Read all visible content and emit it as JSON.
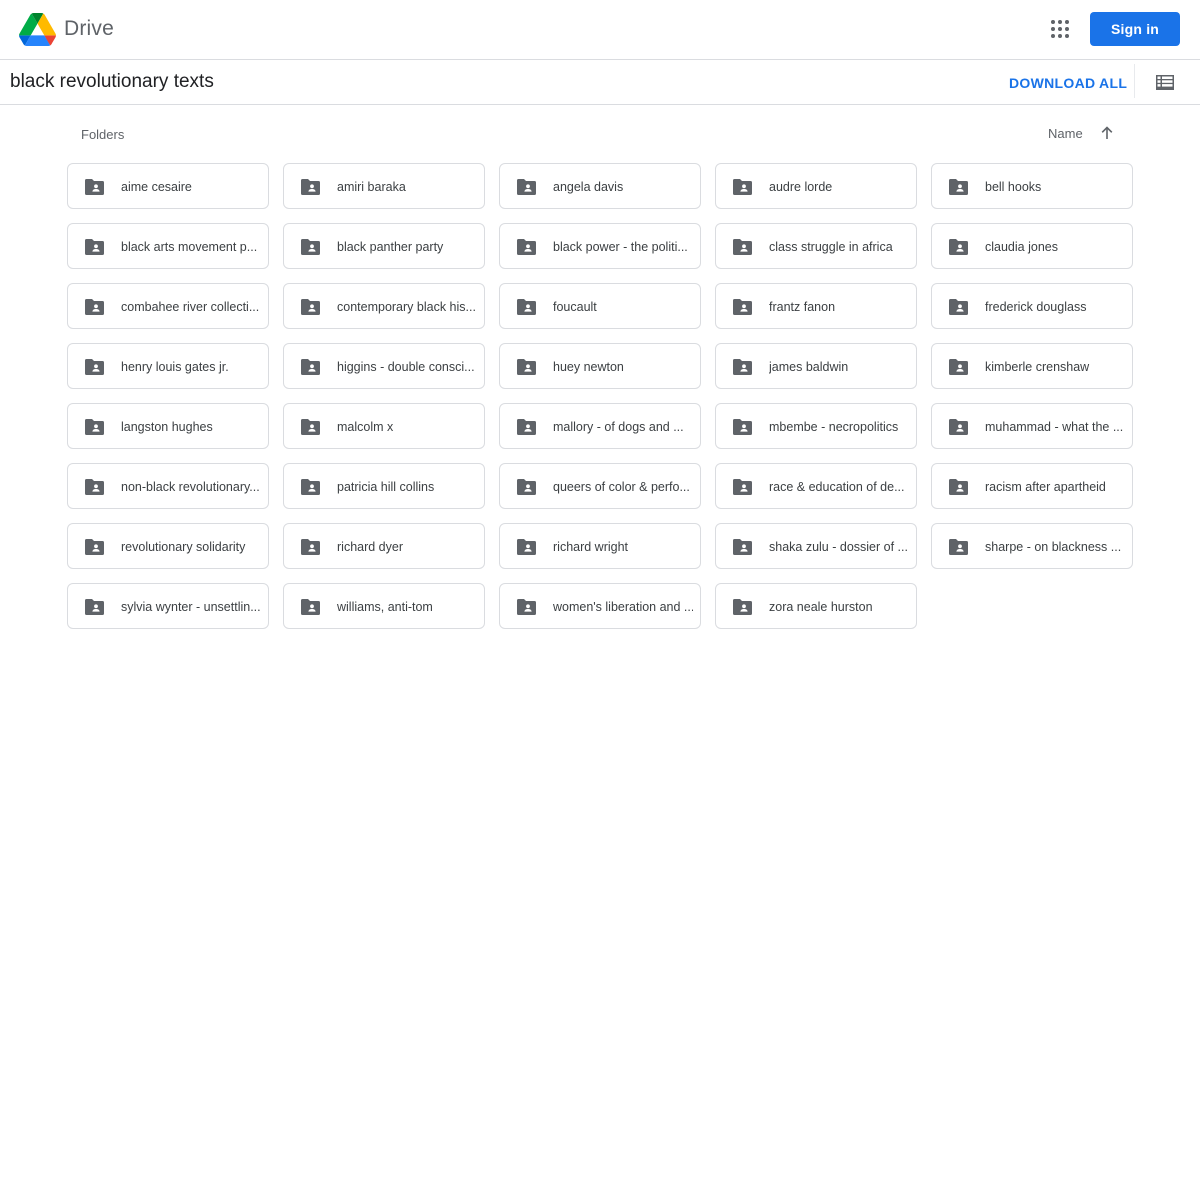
{
  "header": {
    "brand": "Drive",
    "sign_in_label": "Sign in",
    "apps_icon": "apps-grid-icon",
    "accent_color": "#1a73e8"
  },
  "toolbar": {
    "folder_title": "black revolutionary texts",
    "download_all_label": "DOWNLOAD ALL",
    "view_icon": "list-view-icon"
  },
  "section": {
    "label": "Folders",
    "sort_label": "Name",
    "sort_direction": "ascending"
  },
  "folders": [
    {
      "name": "aime cesaire"
    },
    {
      "name": "amiri baraka"
    },
    {
      "name": "angela davis"
    },
    {
      "name": "audre lorde"
    },
    {
      "name": "bell hooks"
    },
    {
      "name": "black arts movement p..."
    },
    {
      "name": "black panther party"
    },
    {
      "name": "black power - the politi..."
    },
    {
      "name": "class struggle in africa"
    },
    {
      "name": "claudia jones"
    },
    {
      "name": "combahee river collecti..."
    },
    {
      "name": "contemporary black his..."
    },
    {
      "name": "foucault"
    },
    {
      "name": "frantz fanon"
    },
    {
      "name": "frederick douglass"
    },
    {
      "name": "henry louis gates jr."
    },
    {
      "name": "higgins - double consci..."
    },
    {
      "name": "huey newton"
    },
    {
      "name": "james baldwin"
    },
    {
      "name": "kimberle crenshaw"
    },
    {
      "name": "langston hughes"
    },
    {
      "name": "malcolm x"
    },
    {
      "name": "mallory - of dogs and ..."
    },
    {
      "name": "mbembe - necropolitics"
    },
    {
      "name": "muhammad - what the ..."
    },
    {
      "name": "non-black revolutionary..."
    },
    {
      "name": "patricia hill collins"
    },
    {
      "name": "queers of color & perfo..."
    },
    {
      "name": "race & education of de..."
    },
    {
      "name": "racism after apartheid"
    },
    {
      "name": "revolutionary solidarity"
    },
    {
      "name": "richard dyer"
    },
    {
      "name": "richard wright"
    },
    {
      "name": "shaka zulu - dossier of ..."
    },
    {
      "name": "sharpe - on blackness ..."
    },
    {
      "name": "sylvia wynter - unsettlin..."
    },
    {
      "name": "williams, anti-tom"
    },
    {
      "name": "women's liberation and ..."
    },
    {
      "name": "zora neale hurston"
    }
  ]
}
